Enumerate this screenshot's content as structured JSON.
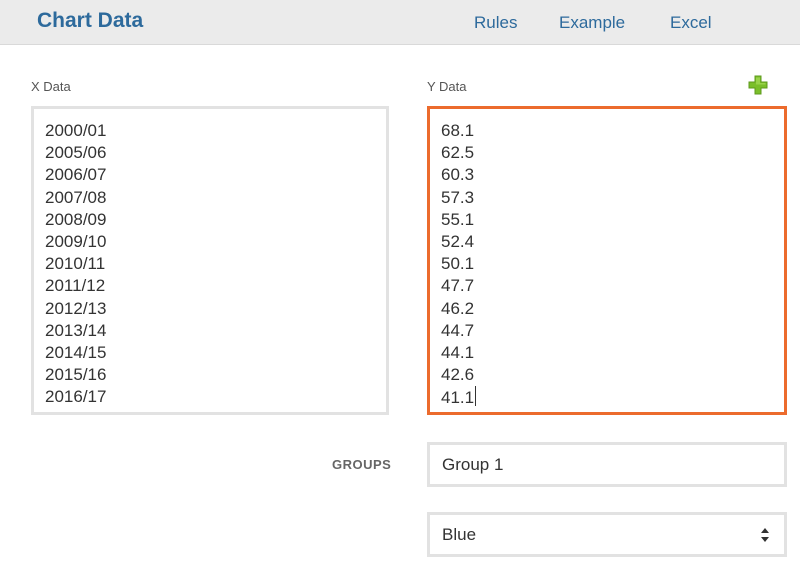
{
  "header": {
    "title": "Chart Data",
    "nav": [
      "Rules",
      "Example",
      "Excel"
    ]
  },
  "x_data": {
    "label": "X Data",
    "lines": [
      "2000/01",
      "2005/06",
      "2006/07",
      "2007/08",
      "2008/09",
      "2009/10",
      "2010/11",
      "2011/12",
      "2012/13",
      "2013/14",
      "2014/15",
      "2015/16",
      "2016/17"
    ]
  },
  "y_data": {
    "label": "Y Data",
    "lines": [
      "68.1",
      "62.5",
      "60.3",
      "57.3",
      "55.1",
      "52.4",
      "50.1",
      "47.7",
      "46.2",
      "44.7",
      "44.1",
      "42.6",
      "41.1"
    ],
    "focused": true
  },
  "groups": {
    "label": "GROUPS",
    "value": "Group 1"
  },
  "color_select": {
    "value": "Blue"
  },
  "icons": {
    "add": "plus-icon",
    "select": "up-down-arrows-icon"
  },
  "colors": {
    "accent": "#2d6a9c",
    "focus_border": "#ec6b2d",
    "add_icon": "#7bbf2a",
    "header_bg": "#ebebeb"
  }
}
